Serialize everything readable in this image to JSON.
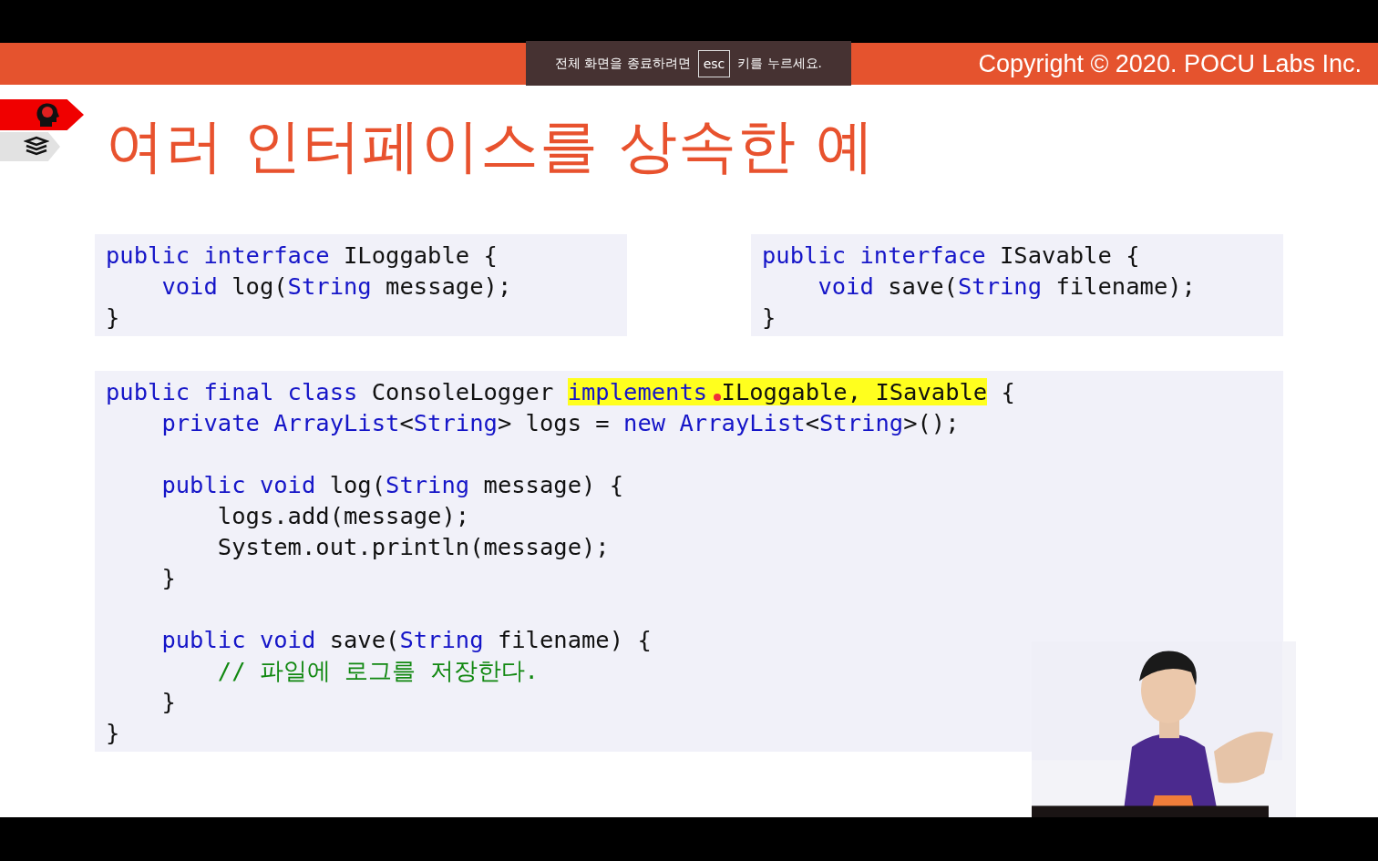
{
  "slide": {
    "copyright": "Copyright © 2020. POCU Labs Inc.",
    "title": "여러 인터페이스를 상속한 예",
    "code_blocks": [
      {
        "sections": [
          {
            "lines": [
              {
                "tokens": [
                  {
                    "text": "public interface ",
                    "kind": "keyword"
                  },
                  {
                    "text": "ILoggable {",
                    "kind": "plain"
                  }
                ]
              },
              {
                "tokens": [
                  {
                    "text": "    void ",
                    "kind": "keyword"
                  },
                  {
                    "text": "log(",
                    "kind": "plain"
                  },
                  {
                    "text": "String",
                    "kind": "keyword"
                  },
                  {
                    "text": " message);",
                    "kind": "plain"
                  }
                ]
              },
              {
                "tokens": [
                  {
                    "text": "}",
                    "kind": "plain"
                  }
                ]
              }
            ]
          }
        ]
      },
      {
        "sections": [
          {
            "lines": [
              {
                "tokens": [
                  {
                    "text": "public interface ",
                    "kind": "keyword"
                  },
                  {
                    "text": "ISavable {",
                    "kind": "plain"
                  }
                ]
              },
              {
                "tokens": [
                  {
                    "text": "    void ",
                    "kind": "keyword"
                  },
                  {
                    "text": "save(",
                    "kind": "plain"
                  },
                  {
                    "text": "String",
                    "kind": "keyword"
                  },
                  {
                    "text": " filename);",
                    "kind": "plain"
                  }
                ]
              },
              {
                "tokens": [
                  {
                    "text": "}",
                    "kind": "plain"
                  }
                ]
              }
            ]
          }
        ]
      },
      {
        "sections": [
          {
            "lines": [
              {
                "tokens": [
                  {
                    "text": "public final class ",
                    "kind": "keyword"
                  },
                  {
                    "text": "ConsoleLogger ",
                    "kind": "plain"
                  },
                  {
                    "text": "implements",
                    "kind": "keyword",
                    "highlighted": true
                  },
                  {
                    "text": " ILoggable, ISavable",
                    "kind": "plain",
                    "highlighted": true
                  },
                  {
                    "text": " {",
                    "kind": "plain"
                  }
                ]
              },
              {
                "tokens": [
                  {
                    "text": "    private ArrayList",
                    "kind": "keyword"
                  },
                  {
                    "text": "<",
                    "kind": "plain"
                  },
                  {
                    "text": "String",
                    "kind": "keyword"
                  },
                  {
                    "text": "> logs = ",
                    "kind": "plain"
                  },
                  {
                    "text": "new ArrayList",
                    "kind": "keyword"
                  },
                  {
                    "text": "<",
                    "kind": "plain"
                  },
                  {
                    "text": "String",
                    "kind": "keyword"
                  },
                  {
                    "text": ">();",
                    "kind": "plain"
                  }
                ]
              }
            ]
          },
          {
            "lines": [
              {
                "tokens": [
                  {
                    "text": "    public void ",
                    "kind": "keyword"
                  },
                  {
                    "text": "log(",
                    "kind": "plain"
                  },
                  {
                    "text": "String",
                    "kind": "keyword"
                  },
                  {
                    "text": " message) {",
                    "kind": "plain"
                  }
                ]
              },
              {
                "tokens": [
                  {
                    "text": "        logs.add(message);",
                    "kind": "plain"
                  }
                ]
              },
              {
                "tokens": [
                  {
                    "text": "        System.out.println(message);",
                    "kind": "plain"
                  }
                ]
              },
              {
                "tokens": [
                  {
                    "text": "    }",
                    "kind": "plain"
                  }
                ]
              }
            ]
          },
          {
            "lines": [
              {
                "tokens": [
                  {
                    "text": "    public void ",
                    "kind": "keyword"
                  },
                  {
                    "text": "save(",
                    "kind": "plain"
                  },
                  {
                    "text": "String",
                    "kind": "keyword"
                  },
                  {
                    "text": " filename) {",
                    "kind": "plain"
                  }
                ]
              },
              {
                "tokens": [
                  {
                    "text": "        // 파일에 로그를 저장한다.",
                    "kind": "comment"
                  }
                ]
              },
              {
                "tokens": [
                  {
                    "text": "    }",
                    "kind": "plain"
                  }
                ]
              },
              {
                "tokens": [
                  {
                    "text": "}",
                    "kind": "plain"
                  }
                ]
              }
            ]
          }
        ]
      }
    ]
  },
  "fullscreen_notice": {
    "before": "전체 화면을 종료하려면",
    "key": "esc",
    "after": "키를 누르세요."
  }
}
